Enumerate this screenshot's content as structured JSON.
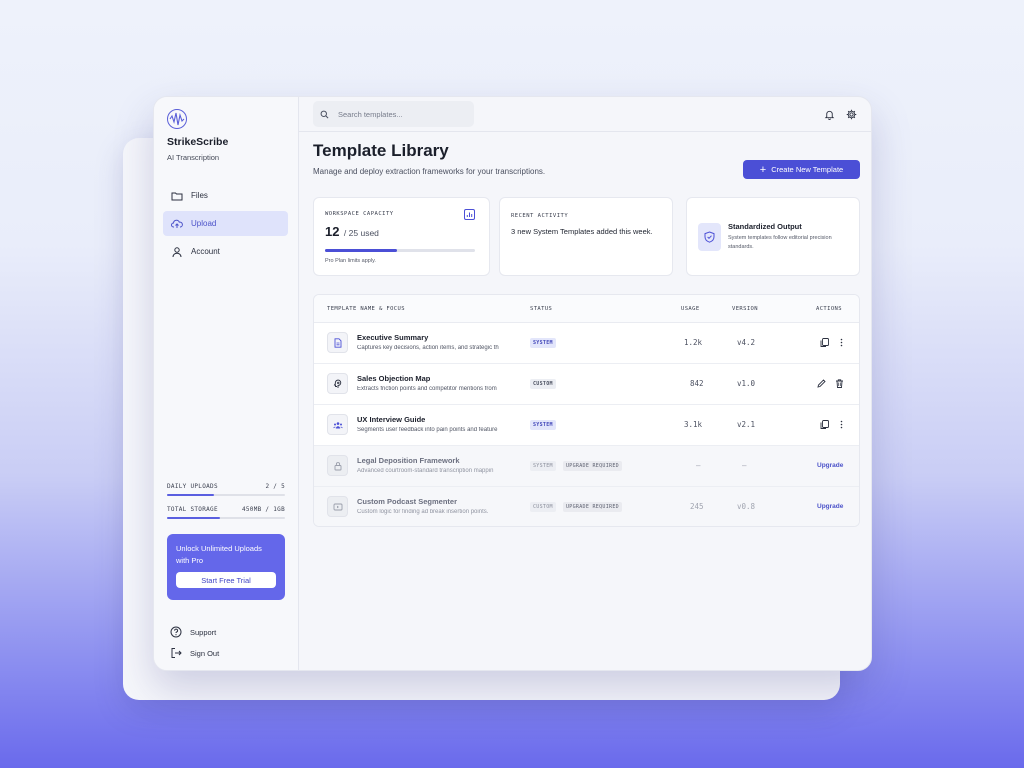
{
  "app": {
    "name": "StrikeScribe",
    "tagline": "AI Transcription"
  },
  "sidebar": {
    "items": [
      {
        "label": "Files",
        "icon": "folder-icon"
      },
      {
        "label": "Upload",
        "icon": "cloud-upload-icon",
        "active": true
      },
      {
        "label": "Account",
        "icon": "user-icon"
      }
    ],
    "daily_uploads": {
      "label": "DAILY UPLOADS",
      "value": "2 / 5",
      "fraction": 0.4
    },
    "total_storage": {
      "label": "TOTAL STORAGE",
      "value": "450MB / 1GB",
      "fraction": 0.45
    },
    "promo": {
      "text": "Unlock Unlimited Uploads with Pro",
      "button": "Start Free Trial"
    },
    "support": "Support",
    "sign_out": "Sign Out"
  },
  "topbar": {
    "search_placeholder": "Search templates..."
  },
  "header": {
    "title": "Template Library",
    "subtitle": "Manage and deploy extraction frameworks for your transcriptions.",
    "create_button": "Create New Template"
  },
  "cards": {
    "capacity": {
      "label": "WORKSPACE CAPACITY",
      "used": "12",
      "of": "/ 25 used",
      "fraction": 0.48,
      "note": "Pro Plan limits apply."
    },
    "activity": {
      "label": "RECENT ACTIVITY",
      "text": "3 new System Templates added this week."
    },
    "output": {
      "title": "Standardized Output",
      "text": "System templates follow editorial precision standards."
    }
  },
  "table": {
    "headers": {
      "name": "TEMPLATE NAME & FOCUS",
      "status": "STATUS",
      "usage": "USAGE",
      "version": "VERSION",
      "actions": "ACTIONS"
    },
    "rows": [
      {
        "name": "Executive Summary",
        "desc": "Captures key decisions, action items, and strategic th",
        "status": "SYSTEM",
        "usage": "1.2k",
        "version": "v4.2",
        "icon": "document-icon"
      },
      {
        "name": "Sales Objection Map",
        "desc": "Extracts friction points and competitor mentions from",
        "status": "CUSTOM",
        "usage": "842",
        "version": "v1.0",
        "icon": "brain-icon"
      },
      {
        "name": "UX Interview Guide",
        "desc": "Segments user feedback into pain points and feature",
        "status": "SYSTEM",
        "usage": "3.1k",
        "version": "v2.1",
        "icon": "users-icon"
      },
      {
        "name": "Legal Deposition Framework",
        "desc": "Advanced courtroom-standard transcription mappin",
        "status": "SYSTEM",
        "extra": "UPGRADE REQUIRED",
        "usage": "—",
        "version": "—",
        "action": "Upgrade",
        "icon": "lock-icon"
      },
      {
        "name": "Custom Podcast Segmenter",
        "desc": "Custom logic for finding ad break insertion points.",
        "status": "CUSTOM",
        "extra": "UPGRADE REQUIRED",
        "usage": "245",
        "version": "v0.8",
        "action": "Upgrade",
        "icon": "video-icon"
      }
    ]
  },
  "colors": {
    "accent": "#4b4fd6",
    "promo": "#6467ea",
    "active_nav": "#dfe3fb"
  }
}
